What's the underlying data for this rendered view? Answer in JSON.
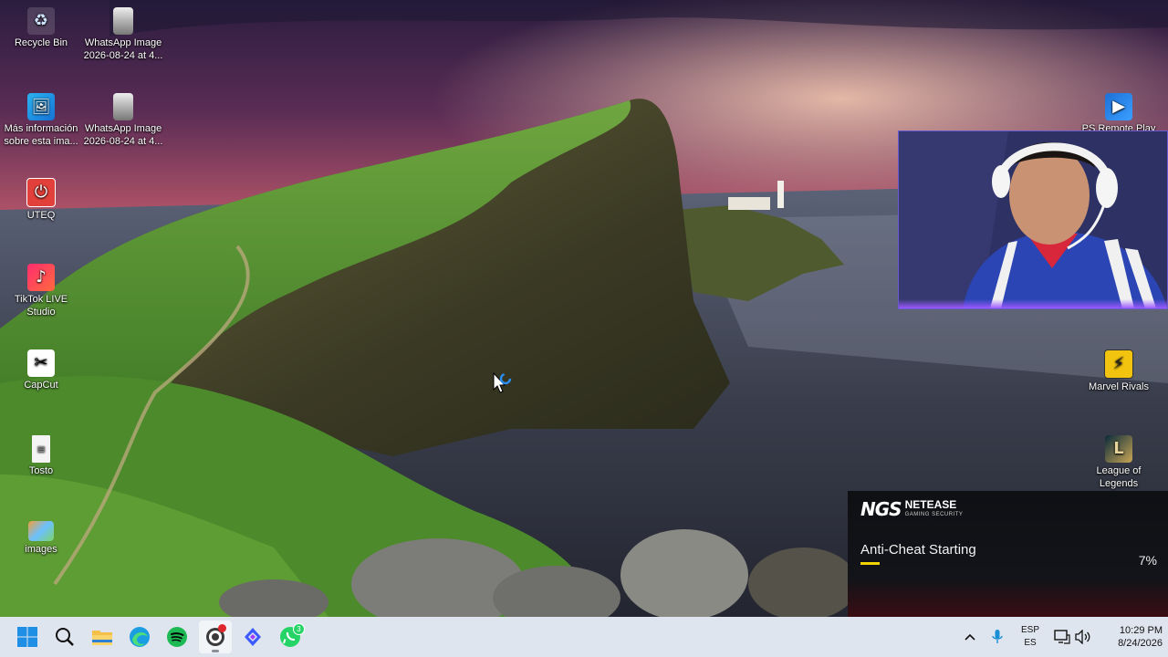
{
  "desktop": {
    "left_icons": [
      {
        "label": "Recycle Bin",
        "icon": "recycle-bin-icon"
      },
      {
        "label": "WhatsApp Image\n2026-08-24 at 4...",
        "icon": "image-file-icon"
      },
      {
        "label": "Más información\nsobre esta ima...",
        "icon": "spotlight-info-icon"
      },
      {
        "label": "WhatsApp Image\n2026-08-24 at 4...",
        "icon": "image-file-icon"
      },
      {
        "label": "UTEQ",
        "icon": "uteq-app-icon"
      },
      {
        "label": "TikTok LIVE\nStudio",
        "icon": "tiktok-live-icon"
      },
      {
        "label": "CapCut",
        "icon": "capcut-icon"
      },
      {
        "label": "Tosto",
        "icon": "text-file-icon"
      },
      {
        "label": "images",
        "icon": "images-folder-icon"
      }
    ],
    "right_icons": [
      {
        "label": "PS Remote Play",
        "icon": "ps-remote-play-icon"
      },
      {
        "label": "Marvel Rivals",
        "icon": "marvel-rivals-icon"
      },
      {
        "label": "League of\nLegends",
        "icon": "league-of-legends-icon"
      }
    ]
  },
  "anticheat": {
    "logo_mark": "NGS",
    "brand": "NETEASE",
    "brand_sub": "GAMING SECURITY",
    "status": "Anti-Cheat Starting",
    "percent": "7%",
    "progress": 0.07,
    "accent": "#f2d500"
  },
  "taskbar": {
    "apps": [
      {
        "name": "start-button",
        "icon": "windows-logo-icon"
      },
      {
        "name": "search-button",
        "icon": "search-icon"
      },
      {
        "name": "file-explorer",
        "icon": "folder-icon"
      },
      {
        "name": "edge",
        "icon": "edge-icon"
      },
      {
        "name": "spotify",
        "icon": "spotify-icon"
      },
      {
        "name": "obs-recording",
        "icon": "obs-icon"
      },
      {
        "name": "capcut-taskbar",
        "icon": "capcut-icon"
      },
      {
        "name": "whatsapp",
        "icon": "whatsapp-icon",
        "badge": "3"
      }
    ],
    "lang_line1": "ESP",
    "lang_line2": "ES",
    "time": "10:29 PM",
    "date": "8/24/2026"
  },
  "colors": {
    "taskbar_bg": "#dfe5ee",
    "spotify_green": "#1db954",
    "whatsapp_green": "#25d366",
    "windows_blue": "#1f8fe5"
  }
}
